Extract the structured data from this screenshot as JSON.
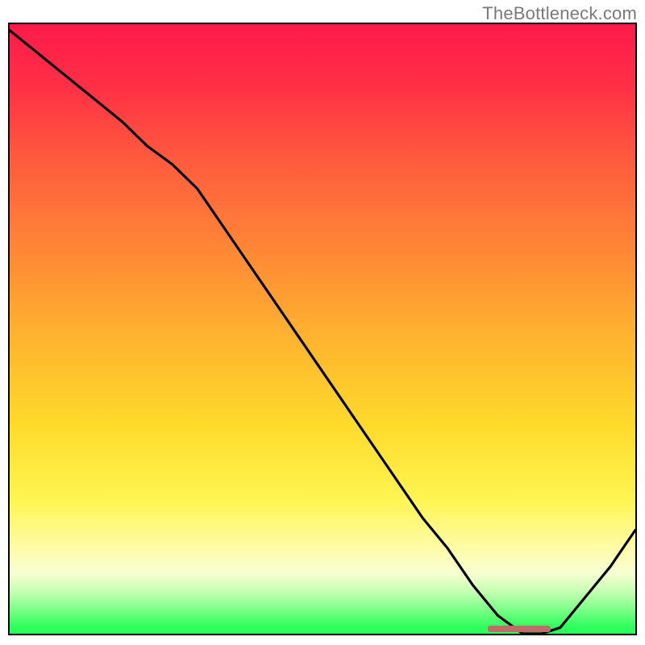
{
  "watermark": "TheBottleneck.com",
  "chart_data": {
    "type": "line",
    "title": "",
    "xlabel": "",
    "ylabel": "",
    "xlim": [
      0,
      100
    ],
    "ylim": [
      0,
      100
    ],
    "grid": false,
    "legend": false,
    "series": [
      {
        "name": "bottleneck-curve",
        "x": [
          0,
          6,
          12,
          18,
          22,
          26,
          30,
          34,
          38,
          42,
          46,
          50,
          54,
          58,
          62,
          66,
          70,
          74,
          78,
          82,
          85,
          88,
          92,
          96,
          100
        ],
        "y": [
          99,
          94,
          89,
          84,
          80,
          77,
          73,
          67,
          61,
          55,
          49,
          43,
          37,
          31,
          25,
          19,
          14,
          8,
          3,
          0,
          0,
          1,
          6,
          11,
          17
        ]
      }
    ],
    "annotations": [
      {
        "name": "optimal-range-marker",
        "type": "rect",
        "x0": 76,
        "x1": 86,
        "y": 0.5,
        "color": "#c06a6a"
      }
    ]
  }
}
